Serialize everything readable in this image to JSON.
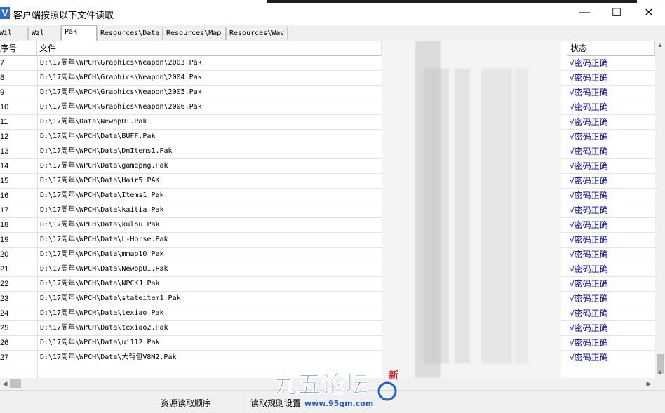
{
  "window": {
    "title": "客户端按照以下文件读取",
    "icon_letter": "V",
    "minimize_glyph": "—",
    "maximize_glyph": "☐",
    "close_glyph": "✕"
  },
  "tabs": [
    {
      "label": "Wil",
      "active": false
    },
    {
      "label": "Wzl",
      "active": false
    },
    {
      "label": "Pak",
      "active": true
    },
    {
      "label": "Resources\\Data",
      "active": false
    },
    {
      "label": "Resources\\Map",
      "active": false
    },
    {
      "label": "Resources\\Wav",
      "active": false
    }
  ],
  "table": {
    "columns": {
      "index": "序号",
      "file": "文件",
      "status": "状态"
    },
    "rows": [
      {
        "index": "7",
        "file": "D:\\17周年\\WPCH\\Graphics\\Weapon\\2003.Pak",
        "status": "√密码正确"
      },
      {
        "index": "8",
        "file": "D:\\17周年\\WPCH\\Graphics\\Weapon\\2004.Pak",
        "status": "√密码正确"
      },
      {
        "index": "9",
        "file": "D:\\17周年\\WPCH\\Graphics\\Weapon\\2005.Pak",
        "status": "√密码正确"
      },
      {
        "index": "10",
        "file": "D:\\17周年\\WPCH\\Graphics\\Weapon\\2006.Pak",
        "status": "√密码正确"
      },
      {
        "index": "11",
        "file": "D:\\17周年\\Data\\NewopUI.Pak",
        "status": "√密码正确"
      },
      {
        "index": "12",
        "file": "D:\\17周年\\WPCH\\Data\\BUFF.Pak",
        "status": "√密码正确"
      },
      {
        "index": "13",
        "file": "D:\\17周年\\WPCH\\Data\\DnItems1.Pak",
        "status": "√密码正确"
      },
      {
        "index": "14",
        "file": "D:\\17周年\\WPCH\\Data\\gamepng.Pak",
        "status": "√密码正确"
      },
      {
        "index": "15",
        "file": "D:\\17周年\\WPCH\\Data\\Hair5.PAK",
        "status": "√密码正确"
      },
      {
        "index": "16",
        "file": "D:\\17周年\\WPCH\\Data\\Items1.Pak",
        "status": "√密码正确"
      },
      {
        "index": "17",
        "file": "D:\\17周年\\WPCH\\Data\\kaitia.Pak",
        "status": "√密码正确"
      },
      {
        "index": "18",
        "file": "D:\\17周年\\WPCH\\Data\\kulou.Pak",
        "status": "√密码正确"
      },
      {
        "index": "19",
        "file": "D:\\17周年\\WPCH\\Data\\L-Horse.Pak",
        "status": "√密码正确"
      },
      {
        "index": "20",
        "file": "D:\\17周年\\WPCH\\Data\\mmap10.Pak",
        "status": "√密码正确"
      },
      {
        "index": "21",
        "file": "D:\\17周年\\WPCH\\Data\\NewopUI.Pak",
        "status": "√密码正确"
      },
      {
        "index": "22",
        "file": "D:\\17周年\\WPCH\\Data\\NPCKJ.Pak",
        "status": "√密码正确"
      },
      {
        "index": "23",
        "file": "D:\\17周年\\WPCH\\Data\\stateitem1.Pak",
        "status": "√密码正确"
      },
      {
        "index": "24",
        "file": "D:\\17周年\\WPCH\\Data\\texiao.Pak",
        "status": "√密码正确"
      },
      {
        "index": "25",
        "file": "D:\\17周年\\WPCH\\Data\\texiao2.Pak",
        "status": "√密码正确"
      },
      {
        "index": "26",
        "file": "D:\\17周年\\WPCH\\Data\\ui112.Pak",
        "status": "√密码正确"
      },
      {
        "index": "27",
        "file": "D:\\17周年\\WPCH\\Data\\大背包V8M2.Pak",
        "status": "√密码正确"
      }
    ]
  },
  "statusbar": {
    "left": "资源读取顺序",
    "right": "读取规则设置"
  },
  "watermark": {
    "text": "九五论坛",
    "badge": "新",
    "url": "www.95gm.com"
  },
  "colors": {
    "status_text": "#0000cc",
    "app_icon": "#2a6fc9",
    "watermark_blue": "#1f5fd6"
  }
}
